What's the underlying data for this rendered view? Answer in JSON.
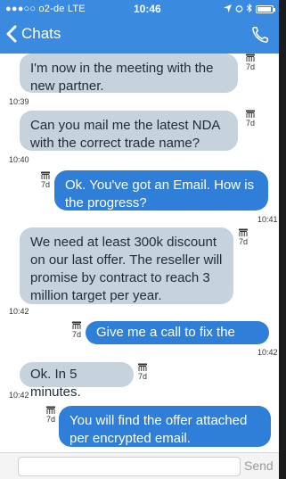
{
  "status_bar": {
    "carrier": "●●●○○ o2-de  LTE",
    "time": "10:46"
  },
  "nav": {
    "back_label": "Chats"
  },
  "colors": {
    "header": "#3a8ae0",
    "incoming_bubble": "#c6d3dd",
    "outgoing_bubble": "#2f7fd8"
  },
  "messages": [
    {
      "direction": "incoming",
      "text": "I'm now in the meeting with the new partner.",
      "age": "7d",
      "time": "10:39"
    },
    {
      "direction": "incoming",
      "text": "Can you mail me the latest NDA with the correct trade name?",
      "age": "7d",
      "time": "10:40"
    },
    {
      "direction": "outgoing",
      "text": "Ok. You've got an Email. How is the progress?",
      "age": "7d",
      "time": "10:41"
    },
    {
      "direction": "incoming",
      "text": "We need at least 300k discount on our last offer. The reseller will promise by contract to reach 3 million target per year.",
      "age": "7d",
      "time": "10:42"
    },
    {
      "direction": "outgoing",
      "text": "Give me a call to fix the details",
      "age": "7d",
      "time": "10:42"
    },
    {
      "direction": "incoming",
      "text": "Ok. In 5 minutes.",
      "age": "7d",
      "time": "10:42"
    },
    {
      "direction": "outgoing",
      "text": "You will find the offer attached per encrypted email.",
      "age": "7d",
      "time": ""
    }
  ],
  "composer": {
    "input_value": "",
    "send_label": "Send"
  }
}
